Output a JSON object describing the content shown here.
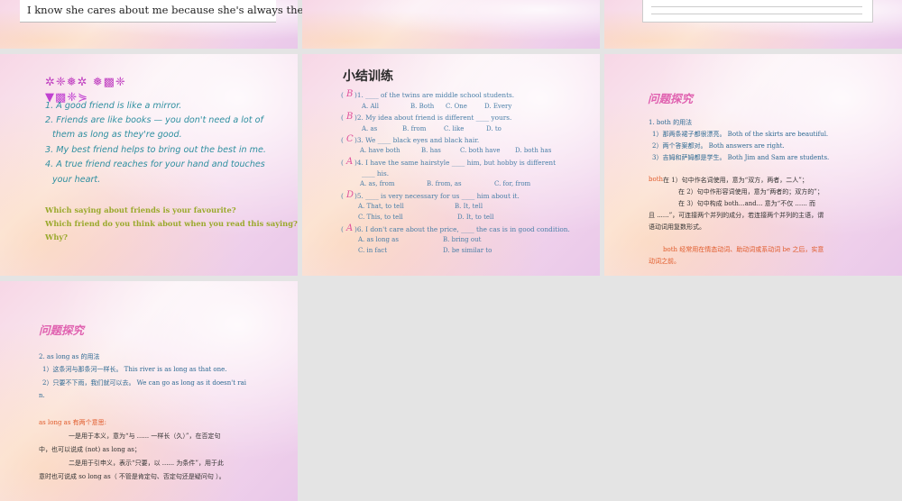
{
  "slide1": {
    "text": "I know she cares about me because she's always there to listen."
  },
  "slide4": {
    "deco_line1": "✲❈❅✲ ❅▩❈",
    "deco_line2": "▼▩❈⋟",
    "sayings": [
      "1. A good friend is like a mirror.",
      "2. Friends are like books — you don't need a lot of",
      "them as long as they're good.",
      "3. My best friend helps to bring out the best in me.",
      "4. A true friend reaches for your hand and touches",
      "your heart."
    ],
    "questions": [
      "Which saying about friends is your favourite?",
      "Which friend do you think about when you read this saying?",
      "Why?"
    ]
  },
  "slide5": {
    "title": "小结训练",
    "items": [
      {
        "ans": "B",
        "q": ")1. ____ of the twins are middle school students.",
        "opts": [
          "A. All",
          "B. Both",
          "C. One",
          "D. Every"
        ]
      },
      {
        "ans": "B",
        "q": ")2. My idea about friend is different ____ yours.",
        "opts": [
          "A. as",
          "B. from",
          "C. like",
          "D. to"
        ]
      },
      {
        "ans": "C",
        "q": ")3. We ____ black eyes and black hair.",
        "opts": [
          "A. have both",
          "B. has",
          "C. both have",
          "D. both has"
        ]
      },
      {
        "ans": "A",
        "q": ")4. I have the same hairstyle ____ him, but hobby is different",
        "q2": "____ his.",
        "opts": [
          "A. as, from",
          "B. from, as",
          "C. for, from"
        ]
      },
      {
        "ans": "D",
        "q": ")5. ____ is very necessary for us ____ him about it.",
        "opts": [
          "A. That, to tell",
          "B. It, tell"
        ],
        "opts2": [
          "C. This, to tell",
          "D. It, to tell"
        ]
      },
      {
        "ans": "A",
        "q": ")6. I don't care about the price, ____ the cas is in good condition.",
        "opts": [
          "A. as long as",
          "B. bring out"
        ],
        "opts2": [
          "C. in fact",
          "D. be similar to"
        ]
      }
    ]
  },
  "slide6": {
    "title": "问题探究",
    "heading": "1. both  的用法",
    "examples": [
      "1）那两条裙子都很漂亮。  Both of the skirts are beautiful.",
      "2）两个答案都对。  Both answers are right.",
      "3）吉姆和萨姆都是学生。  Both Jim and Sam are students."
    ],
    "usage_word": "both",
    "usage": [
      " 在 1）句中作名词使用，意为“双方，两者，二人”；",
      "在 2）句中作形容词使用，意为“两者的；双方的”；",
      "在 3）句中构成   both...and... 意为“不仅 ...... 而",
      "且 ......”，可连接两个并列的成分，若连接两个并列的主语，谓",
      "语动词用复数形式。"
    ],
    "note": [
      "both  经常用在情态动词、助动词或系动词   be  之后，实意",
      "动词之前。"
    ]
  },
  "slide7": {
    "title": "问题探究",
    "heading": "2. as long as  的用法",
    "examples": [
      "1）这条河与那条河一样长。  This river is as long as that one.",
      "2）只要不下雨，我们就可以去。  We can go as long as it doesn't rai",
      "n."
    ],
    "meaning_title": "as long as  有两个意思:",
    "meanings": [
      "一是用于本义，意为“与 ...... 一样长（久）”，在否定句",
      "中，也可以说成   (not) as long as；",
      "二是用于引申义，表示“只要，以 ...... 为条件”，用于此",
      "意时也可说成   so long as（ 不管是肯定句、否定句还是疑问句 ）。"
    ]
  }
}
